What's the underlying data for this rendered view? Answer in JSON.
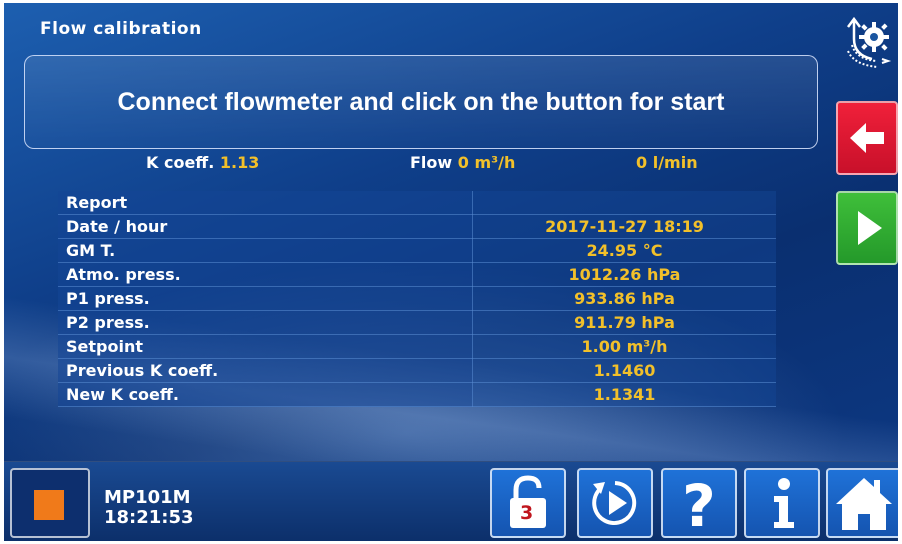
{
  "window": {
    "title": "Flow calibration"
  },
  "message": "Connect flowmeter and click on the button for start",
  "measurements": {
    "k_label": "K coeff.",
    "k_value": "1.13",
    "flow_label": "Flow",
    "flow_value": "0 m³/h",
    "flow_lmin": "0 l/min"
  },
  "report": {
    "header": "Report",
    "rows": [
      {
        "label": "Date / hour",
        "value": "2017-11-27 18:19"
      },
      {
        "label": "GM T.",
        "value": "24.95 °C"
      },
      {
        "label": "Atmo. press.",
        "value": "1012.26 hPa"
      },
      {
        "label": "P1 press.",
        "value": "933.86 hPa"
      },
      {
        "label": "P2 press.",
        "value": "911.79 hPa"
      },
      {
        "label": "Setpoint",
        "value": "1.00 m³/h"
      },
      {
        "label": "Previous K coeff.",
        "value": "1.1460"
      },
      {
        "label": "New K coeff.",
        "value": "1.1341"
      }
    ]
  },
  "status": {
    "device": "MP101M",
    "time": "18:21:53"
  },
  "lock_level": "3",
  "icons": {
    "settings": "settings-rotate-icon",
    "back": "arrow-left-icon",
    "start": "play-icon",
    "stop": "stop-square-icon",
    "lock": "unlock-icon",
    "replay": "replay-icon",
    "help": "question-icon",
    "info": "info-icon",
    "home": "home-icon"
  },
  "colors": {
    "accent_value": "#f2c02a",
    "back_button": "#e0182f",
    "start_button": "#33b030",
    "stop_square": "#f07a1a",
    "lock_digit": "#c0161e"
  }
}
